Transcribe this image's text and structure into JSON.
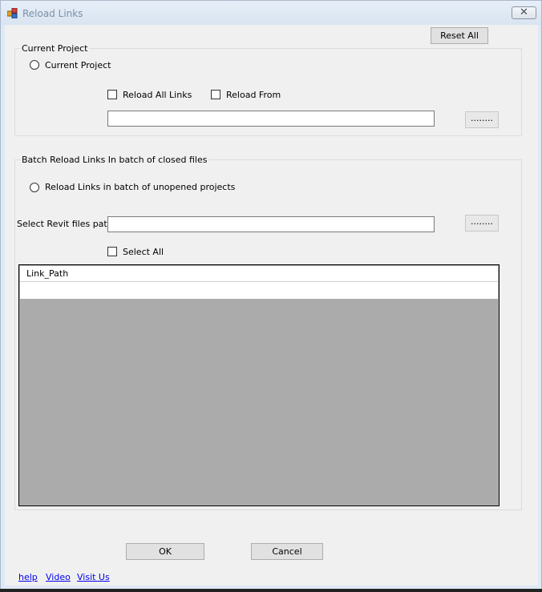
{
  "window": {
    "title": "Reload Links",
    "close_glyph": "✕"
  },
  "toolbar": {
    "reset_all": "Reset All"
  },
  "current_project": {
    "group_label": "Current Project",
    "radio_label": "Current Project",
    "reload_all_links": "Reload All Links",
    "reload_from": "Reload From",
    "path_value": "",
    "browse_label": "........"
  },
  "batch": {
    "group_label": "Batch Reload Links In batch of closed files",
    "radio_label": "Reload Links in batch of unopened projects",
    "path_label": "Select Revit files path",
    "path_value": "",
    "browse_label": "........",
    "select_all": "Select All",
    "grid": {
      "columns": [
        "Link_Path"
      ],
      "rows": [
        [
          ""
        ]
      ]
    }
  },
  "footer": {
    "ok": "OK",
    "cancel": "Cancel",
    "links": [
      "help",
      "Video",
      "Visit Us"
    ]
  },
  "icons": {
    "app": "links-app-icon",
    "close": "close-icon"
  }
}
